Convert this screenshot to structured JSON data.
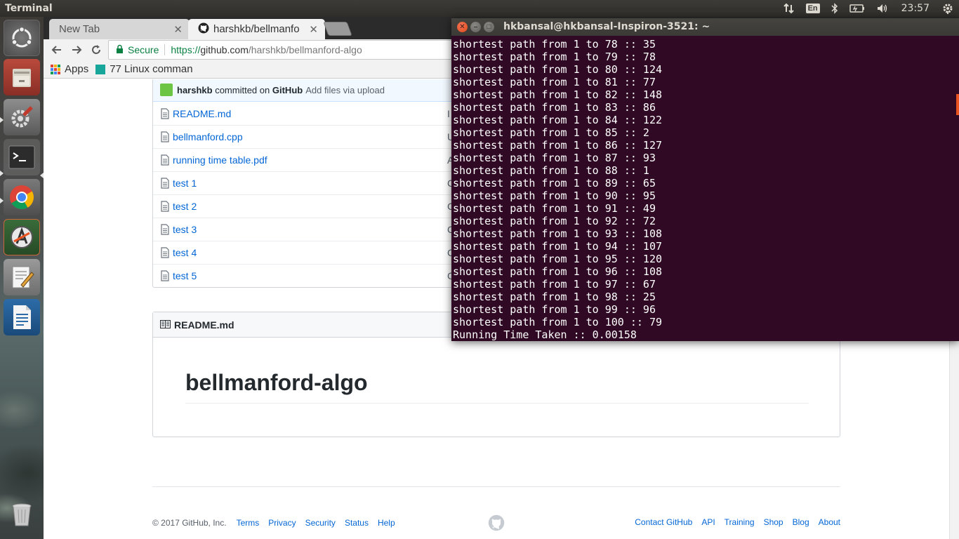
{
  "panel": {
    "app_title": "Terminal",
    "language": "En",
    "clock": "23:57"
  },
  "launcher": {
    "items": [
      "ubuntu-dash",
      "files",
      "system-settings",
      "terminal",
      "chrome",
      "software-updater",
      "text-editor",
      "libreoffice-writer",
      "trash"
    ]
  },
  "chrome": {
    "tabs": [
      {
        "label": "New Tab"
      },
      {
        "label": "harshkb/bellmanfo"
      }
    ],
    "omnibox": {
      "secure_label": "Secure",
      "url_scheme": "https://",
      "url_host": "github.com",
      "url_path": "/harshkb/bellmanford-algo"
    },
    "bookmarks": [
      {
        "label": "Apps"
      },
      {
        "label": "77 Linux comman"
      }
    ]
  },
  "github": {
    "commit": {
      "author": "harshkb",
      "committed_on": "committed on",
      "platform": "GitHub",
      "message": "Add files via upload"
    },
    "files": [
      {
        "name": "README.md",
        "msg": "I"
      },
      {
        "name": "bellmanford.cpp",
        "msg": "U"
      },
      {
        "name": "running time table.pdf",
        "msg": "A"
      },
      {
        "name": "test 1",
        "msg": "C"
      },
      {
        "name": "test 2",
        "msg": "C"
      },
      {
        "name": "test 3",
        "msg": "C"
      },
      {
        "name": "test 4",
        "msg": "C"
      },
      {
        "name": "test 5",
        "msg": "C"
      }
    ],
    "readme": {
      "header": "README.md",
      "title": "bellmanford-algo"
    },
    "footer": {
      "copyright": "© 2017 GitHub, Inc.",
      "left_links": [
        "Terms",
        "Privacy",
        "Security",
        "Status",
        "Help"
      ],
      "right_links": [
        "Contact GitHub",
        "API",
        "Training",
        "Shop",
        "Blog",
        "About"
      ]
    }
  },
  "terminal": {
    "title": "hkbansal@hkbansal-Inspiron-3521: ~",
    "lines": [
      "shortest path from 1 to 78 :: 35",
      "shortest path from 1 to 79 :: 78",
      "shortest path from 1 to 80 :: 124",
      "shortest path from 1 to 81 :: 77",
      "shortest path from 1 to 82 :: 148",
      "shortest path from 1 to 83 :: 86",
      "shortest path from 1 to 84 :: 122",
      "shortest path from 1 to 85 :: 2",
      "shortest path from 1 to 86 :: 127",
      "shortest path from 1 to 87 :: 93",
      "shortest path from 1 to 88 :: 1",
      "shortest path from 1 to 89 :: 65",
      "shortest path from 1 to 90 :: 95",
      "shortest path from 1 to 91 :: 49",
      "shortest path from 1 to 92 :: 72",
      "shortest path from 1 to 93 :: 108",
      "shortest path from 1 to 94 :: 107",
      "shortest path from 1 to 95 :: 120",
      "shortest path from 1 to 96 :: 108",
      "shortest path from 1 to 97 :: 67",
      "shortest path from 1 to 98 :: 25",
      "shortest path from 1 to 99 :: 96",
      "shortest path from 1 to 100 :: 79",
      "Running Time Taken :: 0.00158"
    ]
  }
}
